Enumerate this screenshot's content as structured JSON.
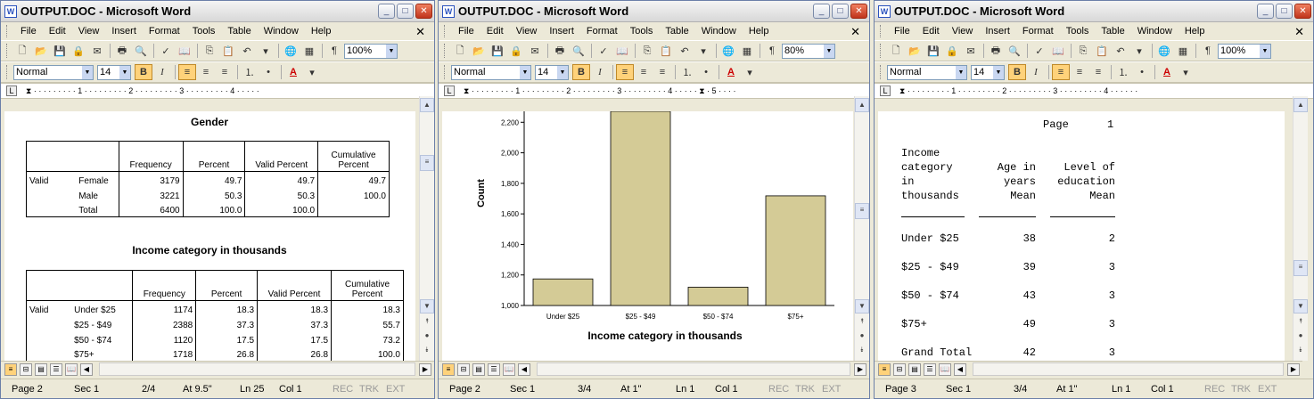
{
  "windows": [
    {
      "title": "OUTPUT.DOC - Microsoft Word",
      "zoom": "100%",
      "style": "Normal",
      "font_size": "14",
      "status": {
        "page": "Page 2",
        "sec": "Sec 1",
        "pages": "2/4",
        "at": "At 9.5\"",
        "ln": "Ln 25",
        "col": "Col 1"
      }
    },
    {
      "title": "OUTPUT.DOC - Microsoft Word",
      "zoom": "80%",
      "style": "Normal",
      "font_size": "14",
      "status": {
        "page": "Page 2",
        "sec": "Sec 1",
        "pages": "3/4",
        "at": "At 1\"",
        "ln": "Ln 1",
        "col": "Col 1"
      }
    },
    {
      "title": "OUTPUT.DOC - Microsoft Word",
      "zoom": "100%",
      "style": "Normal",
      "font_size": "14",
      "status": {
        "page": "Page 3",
        "sec": "Sec 1",
        "pages": "3/4",
        "at": "At 1\"",
        "ln": "Ln 1",
        "col": "Col 1"
      }
    }
  ],
  "menu": [
    "File",
    "Edit",
    "View",
    "Insert",
    "Format",
    "Tools",
    "Table",
    "Window",
    "Help"
  ],
  "status_flags": [
    "REC",
    "TRK",
    "EXT"
  ],
  "gender_table": {
    "title": "Gender",
    "headers": [
      "Frequency",
      "Percent",
      "Valid Percent",
      "Cumulative Percent"
    ],
    "group": "Valid",
    "rows": [
      [
        "Female",
        "3179",
        "49.7",
        "49.7",
        "49.7"
      ],
      [
        "Male",
        "3221",
        "50.3",
        "50.3",
        "100.0"
      ],
      [
        "Total",
        "6400",
        "100.0",
        "100.0",
        ""
      ]
    ]
  },
  "income_table": {
    "title": "Income category in thousands",
    "headers": [
      "Frequency",
      "Percent",
      "Valid Percent",
      "Cumulative Percent"
    ],
    "group": "Valid",
    "rows": [
      [
        "Under $25",
        "1174",
        "18.3",
        "18.3",
        "18.3"
      ],
      [
        "$25 - $49",
        "2388",
        "37.3",
        "37.3",
        "55.7"
      ],
      [
        "$50 - $74",
        "1120",
        "17.5",
        "17.5",
        "73.2"
      ],
      [
        "$75+",
        "1718",
        "26.8",
        "26.8",
        "100.0"
      ]
    ]
  },
  "chart_data": {
    "type": "bar",
    "categories": [
      "Under $25",
      "$25 - $49",
      "$50 - $74",
      "$75+"
    ],
    "values": [
      1174,
      2388,
      1120,
      1718
    ],
    "xlabel": "Income category in thousands",
    "ylabel": "Count",
    "ylim": [
      1000,
      2260
    ],
    "yticks": [
      "1,000",
      "1,200",
      "1,400",
      "1,600",
      "1,800",
      "2,000",
      "2,200"
    ],
    "ytick_values": [
      1000,
      1200,
      1400,
      1600,
      1800,
      2000,
      2200
    ],
    "color": "#d4cb96"
  },
  "means_report": {
    "page_label": "Page      1",
    "col1": [
      "Income",
      "category",
      "in",
      "thousands"
    ],
    "col2": [
      "Age in",
      "years",
      "Mean"
    ],
    "col3": [
      "Level of",
      "education",
      "Mean"
    ],
    "rows": [
      [
        "Under $25",
        "38",
        "2"
      ],
      [
        "$25 - $49",
        "39",
        "3"
      ],
      [
        "$50 - $74",
        "43",
        "3"
      ],
      [
        "$75+",
        "49",
        "3"
      ],
      [
        "Grand Total",
        "42",
        "3"
      ]
    ]
  }
}
